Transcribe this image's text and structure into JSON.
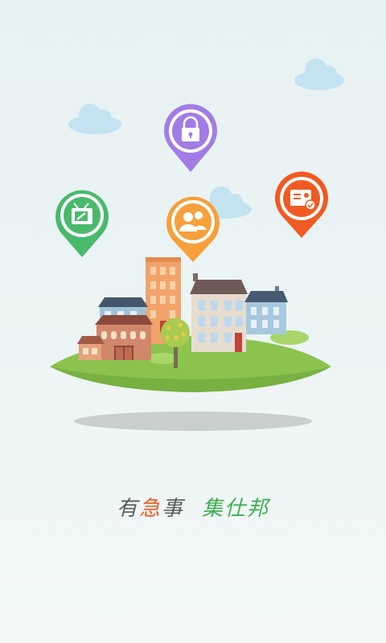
{
  "slogan": {
    "part1": "有",
    "part2": "急",
    "part3": "事",
    "part4": "集仕邦"
  },
  "colors": {
    "pin_purple": "#a27ce6",
    "pin_orange": "#f7a03c",
    "pin_green": "#49b96c",
    "pin_red": "#f05a23",
    "ground_green": "#8cc34f",
    "cloud": "#bfe1f1"
  },
  "icons": [
    "lock-icon",
    "tv-repair-icon",
    "people-icon",
    "id-card-check-icon"
  ]
}
